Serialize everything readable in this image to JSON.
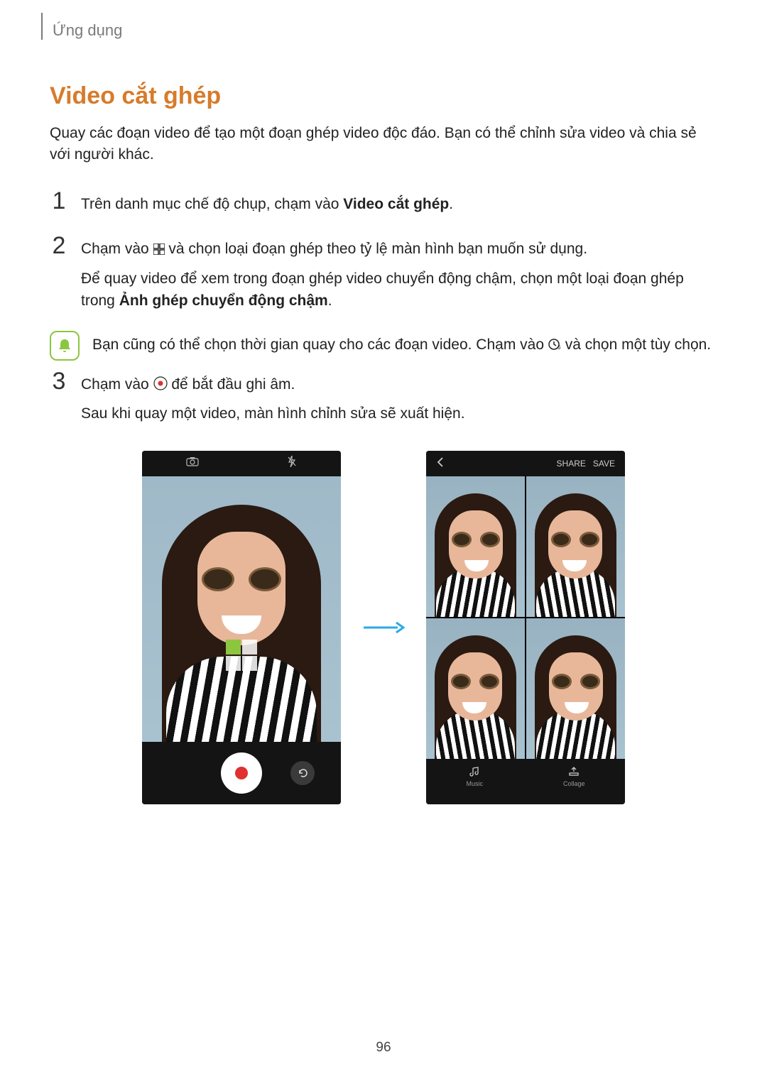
{
  "chapter": "Ứng dụng",
  "title": "Video cắt ghép",
  "intro": "Quay các đoạn video để tạo một đoạn ghép video độc đáo. Bạn có thể chỉnh sửa video và chia sẻ với người khác.",
  "steps": {
    "s1": {
      "num": "1",
      "pre": "Trên danh mục chế độ chụp, chạm vào ",
      "bold": "Video cắt ghép",
      "post": "."
    },
    "s2": {
      "num": "2",
      "line1_pre": "Chạm vào ",
      "line1_post": " và chọn loại đoạn ghép theo tỷ lệ màn hình bạn muốn sử dụng.",
      "line2_pre": "Để quay video để xem trong đoạn ghép video chuyển động chậm, chọn một loại đoạn ghép trong ",
      "line2_bold": "Ảnh ghép chuyển động chậm",
      "line2_post": "."
    },
    "s3": {
      "num": "3",
      "line1_pre": "Chạm vào ",
      "line1_post": " để bắt đầu ghi âm.",
      "line2": "Sau khi quay một video, màn hình chỉnh sửa sẽ xuất hiện."
    }
  },
  "tip": {
    "pre": "Bạn cũng có thể chọn thời gian quay cho các đoạn video. Chạm vào ",
    "post": " và chọn một tùy chọn."
  },
  "phone2": {
    "share": "SHARE",
    "save": "SAVE",
    "music": "Music",
    "collage": "Collage"
  },
  "pagenum": "96"
}
